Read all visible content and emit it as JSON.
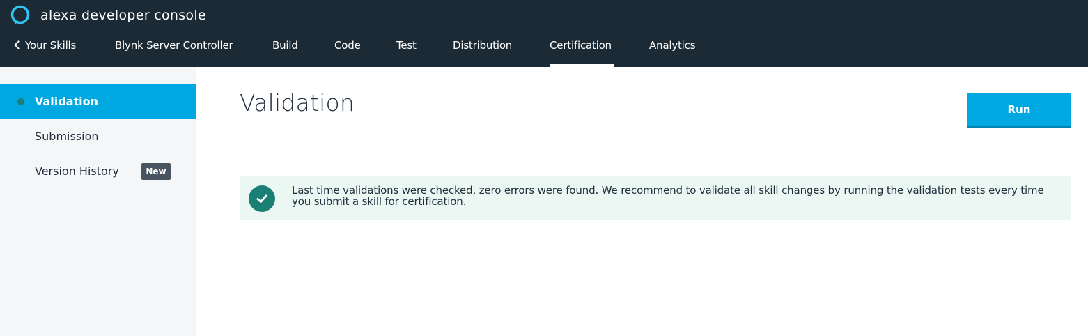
{
  "header": {
    "brand": "alexa developer console",
    "logo_icon": "alexa-ring-icon",
    "nav": {
      "back": "Your Skills",
      "skill_name": "Blynk Server Controller",
      "build": "Build",
      "code": "Code",
      "test": "Test",
      "distribution": "Distribution",
      "certification": "Certification",
      "analytics": "Analytics",
      "active": "Certification"
    }
  },
  "sidebar": {
    "items": [
      {
        "label": "Validation",
        "active": true
      },
      {
        "label": "Submission",
        "active": false
      },
      {
        "label": "Version History",
        "active": false,
        "badge": "New"
      }
    ]
  },
  "main": {
    "title": "Validation",
    "run_label": "Run",
    "alert": {
      "status": "success",
      "icon": "check-circle-icon",
      "text": "Last time validations were checked, zero errors were found. We recommend to validate all skill changes by running the validation tests every time you submit a skill for certification."
    }
  },
  "colors": {
    "header_bg": "#1b2a35",
    "accent": "#00a8e1",
    "success": "#1a7f74",
    "alert_bg": "#ebf7f2",
    "sidebar_bg": "#f4f6f8"
  }
}
